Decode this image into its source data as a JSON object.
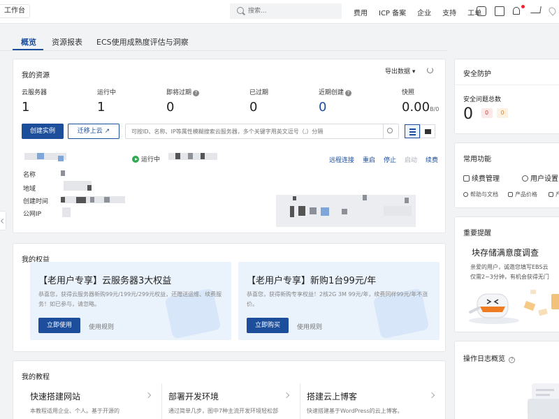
{
  "topbar": {
    "workspace": "工作台",
    "search_placeholder": "搜索...",
    "nav": [
      "费用",
      "ICP 备案",
      "企业",
      "支持",
      "工单"
    ]
  },
  "tabs": [
    "概览",
    "资源报表",
    "ECS使用成熟度评估与洞察"
  ],
  "resources": {
    "title": "我的资源",
    "export": "导出数据 ▾",
    "stats": [
      {
        "label": "云服务器",
        "value": "1"
      },
      {
        "label": "运行中",
        "value": "1"
      },
      {
        "label": "即将过期",
        "value": "0"
      },
      {
        "label": "已过期",
        "value": "0"
      },
      {
        "label": "近期创建",
        "value": "0"
      },
      {
        "label": "快照",
        "value": "0.00",
        "unit": "B/0"
      }
    ],
    "create_button": "创建实例",
    "migrate_button": "迁移上云",
    "search_placeholder": "可按ID、名称、IP等属性模糊搜索云服务器，多个关键字用英文逗号（,）分隔",
    "instance": {
      "status": "运行中",
      "actions": [
        "远程连接",
        "重启",
        "停止",
        "启动",
        "续费"
      ],
      "fields": [
        "名称",
        "地域",
        "创建时间",
        "公网IP"
      ]
    }
  },
  "benefits": {
    "title": "我的权益",
    "cards": [
      {
        "title": "【老用户专享】云服务器3大权益",
        "desc": "恭喜您，获得云服务器新购99元/199元/299元权益，还赠送运维、续费服务！如已参与，请忽略。",
        "button": "立即使用",
        "rule": "使用规则"
      },
      {
        "title": "【老用户专享】新购1台99元/年",
        "desc": "恭喜您，获得新购专享权益！2核2G 3M 99元/年，续费同样99元/年不涨价。",
        "button": "立即购买",
        "rule": "使用规则"
      }
    ]
  },
  "tutorials": {
    "title": "我的教程",
    "items": [
      {
        "title": "快速搭建网站",
        "desc": "本教程适用企业、个人。基于开源的"
      },
      {
        "title": "部署开发环境",
        "desc": "通过简单几步，图中7种主流开发环境轻松部"
      },
      {
        "title": "搭建云上博客",
        "desc": "快速搭建基于WordPress的云上博客。"
      }
    ]
  },
  "security": {
    "title": "安全防护",
    "subtitle": "安全问题总数",
    "total": "0",
    "badges": [
      "0",
      "0"
    ]
  },
  "functions": {
    "title": "常用功能",
    "items": [
      "续费管理",
      "用户设置"
    ],
    "links": [
      "帮助与文档",
      "产品价格",
      "产"
    ]
  },
  "notice": {
    "title": "重要提醒",
    "headline": "块存储满意度调查",
    "lines": [
      "亲爱的用户，诚邀您填写EBS云",
      "仅需2~3分钟，有机会获得无门"
    ]
  },
  "oplog": {
    "title": "操作日志概览"
  },
  "colors": {
    "brand": "#1c4e9c",
    "running": "#33a853"
  }
}
